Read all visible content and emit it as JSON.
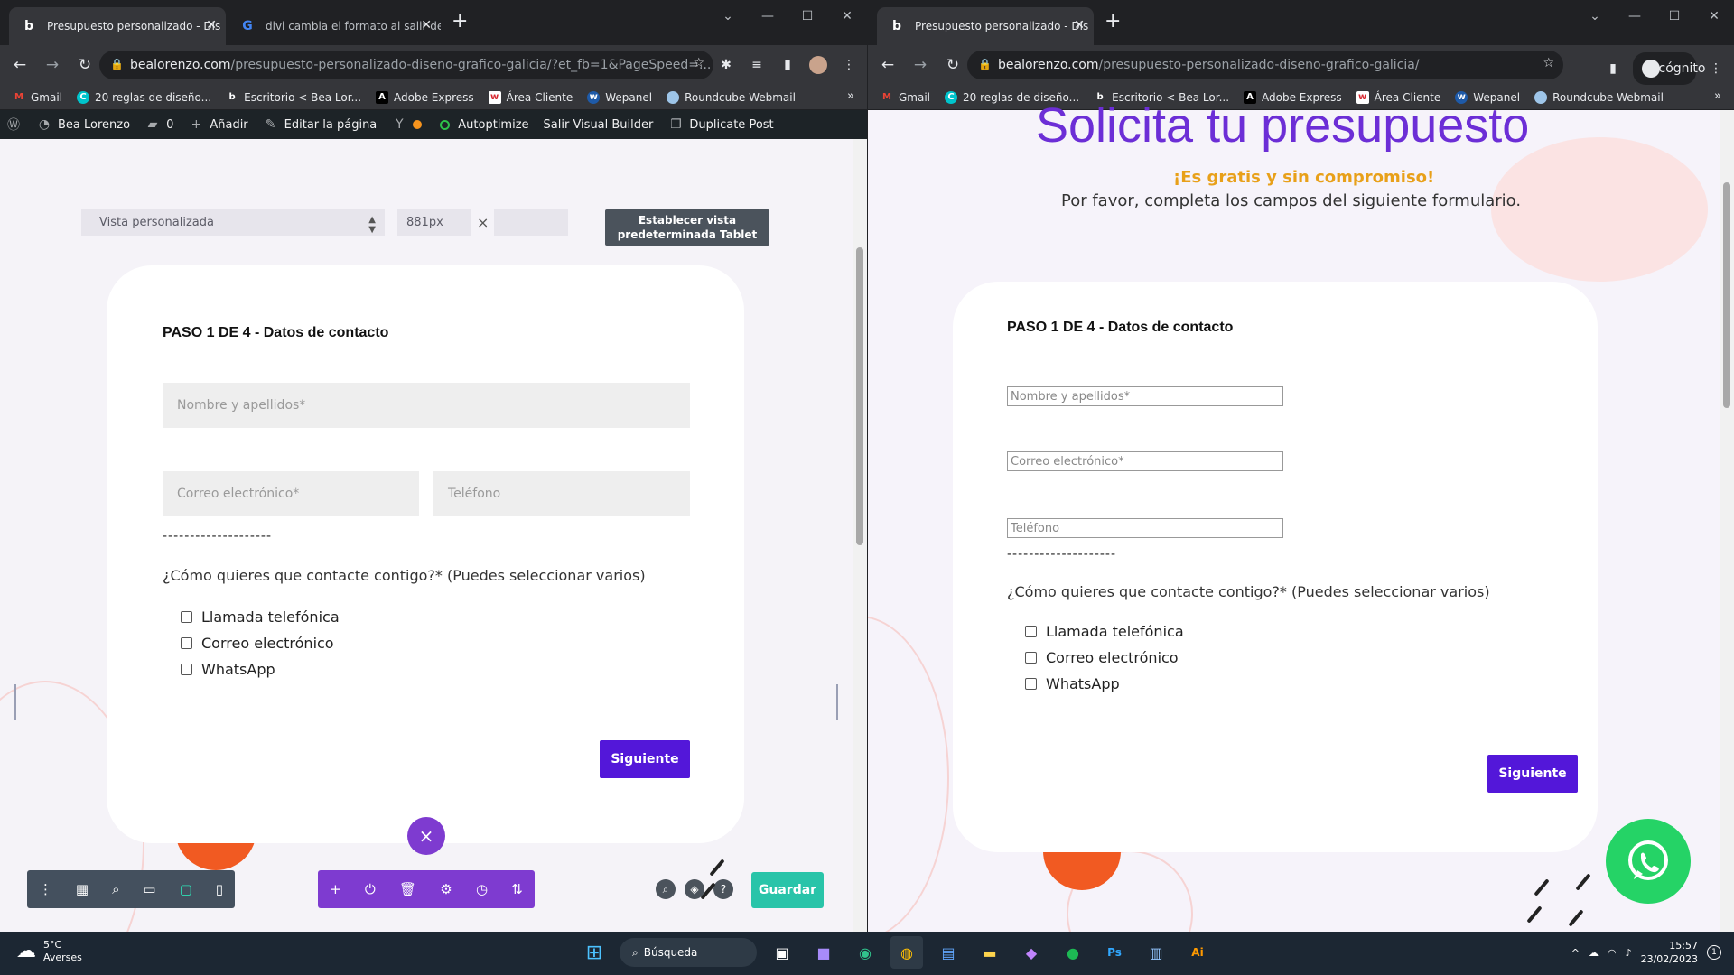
{
  "left_window": {
    "tabs": [
      {
        "title": "Presupuesto personalizado - Dis",
        "favicon": "b"
      },
      {
        "title": "divi cambia el formato al salir del",
        "favicon": "G"
      }
    ],
    "url_host": "bealorenzo.com",
    "url_path": "/presupuesto-personalizado-diseno-grafico-galicia/?et_fb=1&PageSpeed=...",
    "wp_admin_bar": {
      "site": "Bea Lorenzo",
      "comments": "0",
      "add": "Añadir",
      "edit": "Editar la página",
      "autoptimize": "Autoptimize",
      "exit_builder": "Salir Visual Builder",
      "duplicate": "Duplicate Post"
    },
    "view_controls": {
      "select_value": "Vista personalizada",
      "width_value": "881px",
      "times": "×",
      "set_default_button": "Establecer vista predeterminada Tablet"
    },
    "form": {
      "step_title": "PASO 1 DE 4 - Datos de contacto",
      "name_placeholder": "Nombre y apellidos*",
      "email_placeholder": "Correo electrónico*",
      "phone_placeholder": "Teléfono",
      "dashes": "--------------------",
      "question": "¿Cómo quieres que contacte contigo?* (Puedes seleccionar varios)",
      "options": [
        "Llamada telefónica",
        "Correo electrónico",
        "WhatsApp"
      ],
      "next_button": "Siguiente"
    },
    "save_button": "Guardar",
    "close_icon": "×"
  },
  "right_window": {
    "tabs": [
      {
        "title": "Presupuesto personalizado - Dis",
        "favicon": "b"
      }
    ],
    "url_host": "bealorenzo.com",
    "url_path": "/presupuesto-personalizado-diseno-grafico-galicia/",
    "incognito_label": "Incógnito",
    "hero_title": "Solicita tu presupuesto",
    "free_text": "¡Es gratis y sin compromiso!",
    "instruction": "Por favor, completa los campos del siguiente formulario.",
    "form": {
      "step_title": "PASO 1 DE 4 - Datos de contacto",
      "name_placeholder": "Nombre y apellidos*",
      "email_placeholder": "Correo electrónico*",
      "phone_placeholder": "Teléfono",
      "dashes": "--------------------",
      "question": "¿Cómo quieres que contacte contigo?* (Puedes seleccionar varios)",
      "options": [
        "Llamada telefónica",
        "Correo electrónico",
        "WhatsApp"
      ],
      "next_button": "Siguiente"
    }
  },
  "bookmarks": [
    "Gmail",
    "20 reglas de diseño...",
    "Escritorio < Bea Lor...",
    "Adobe Express",
    "Área Cliente",
    "Wepanel",
    "Roundcube Webmail"
  ],
  "taskbar": {
    "temperature": "5°C",
    "location": "Averses",
    "search_label": "Búsqueda",
    "time": "15:57",
    "date": "23/02/2023",
    "notification_count": "1"
  },
  "colors": {
    "accent_purple": "#5317d9",
    "hero_purple": "#6c2ed6",
    "free_orange": "#e8a019",
    "save_green": "#29c4a9",
    "whatsapp_green": "#25d366"
  }
}
